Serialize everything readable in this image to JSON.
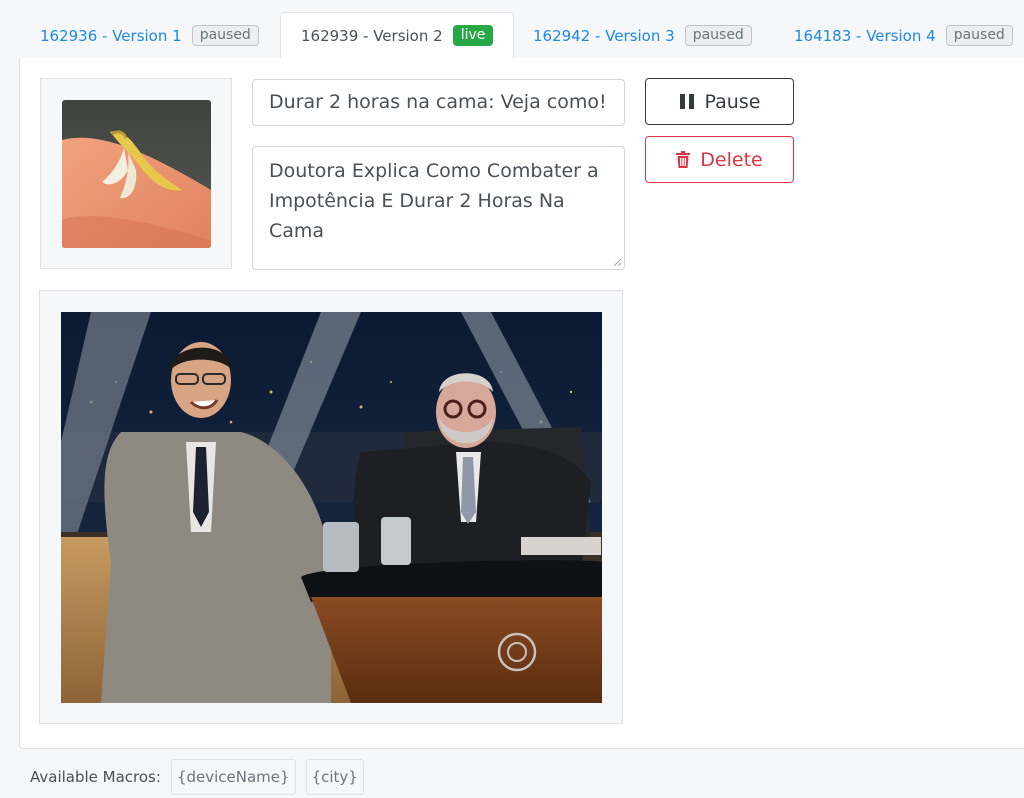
{
  "tabs": [
    {
      "label": "162936 - Version 1",
      "status": "paused"
    },
    {
      "label": "162939 - Version 2",
      "status": "live"
    },
    {
      "label": "162942 - Version 3",
      "status": "paused"
    },
    {
      "label": "164183 - Version 4",
      "status": "paused"
    }
  ],
  "ad": {
    "title_value": "Durar 2 horas na cama: Veja como!",
    "description_value": "Doutora Explica Como Combater a Impotência E Durar 2 Horas Na Cama"
  },
  "actions": {
    "pause_label": "Pause",
    "delete_label": "Delete"
  },
  "macros": {
    "label": "Available Macros:",
    "items": [
      "{deviceName}",
      "{city}"
    ]
  },
  "icons": {
    "pause": "pause-icon",
    "delete": "trash-icon"
  },
  "colors": {
    "link": "#1e88e5",
    "live_badge": "#28a745",
    "delete": "#dc3545",
    "pause": "#343a40"
  }
}
